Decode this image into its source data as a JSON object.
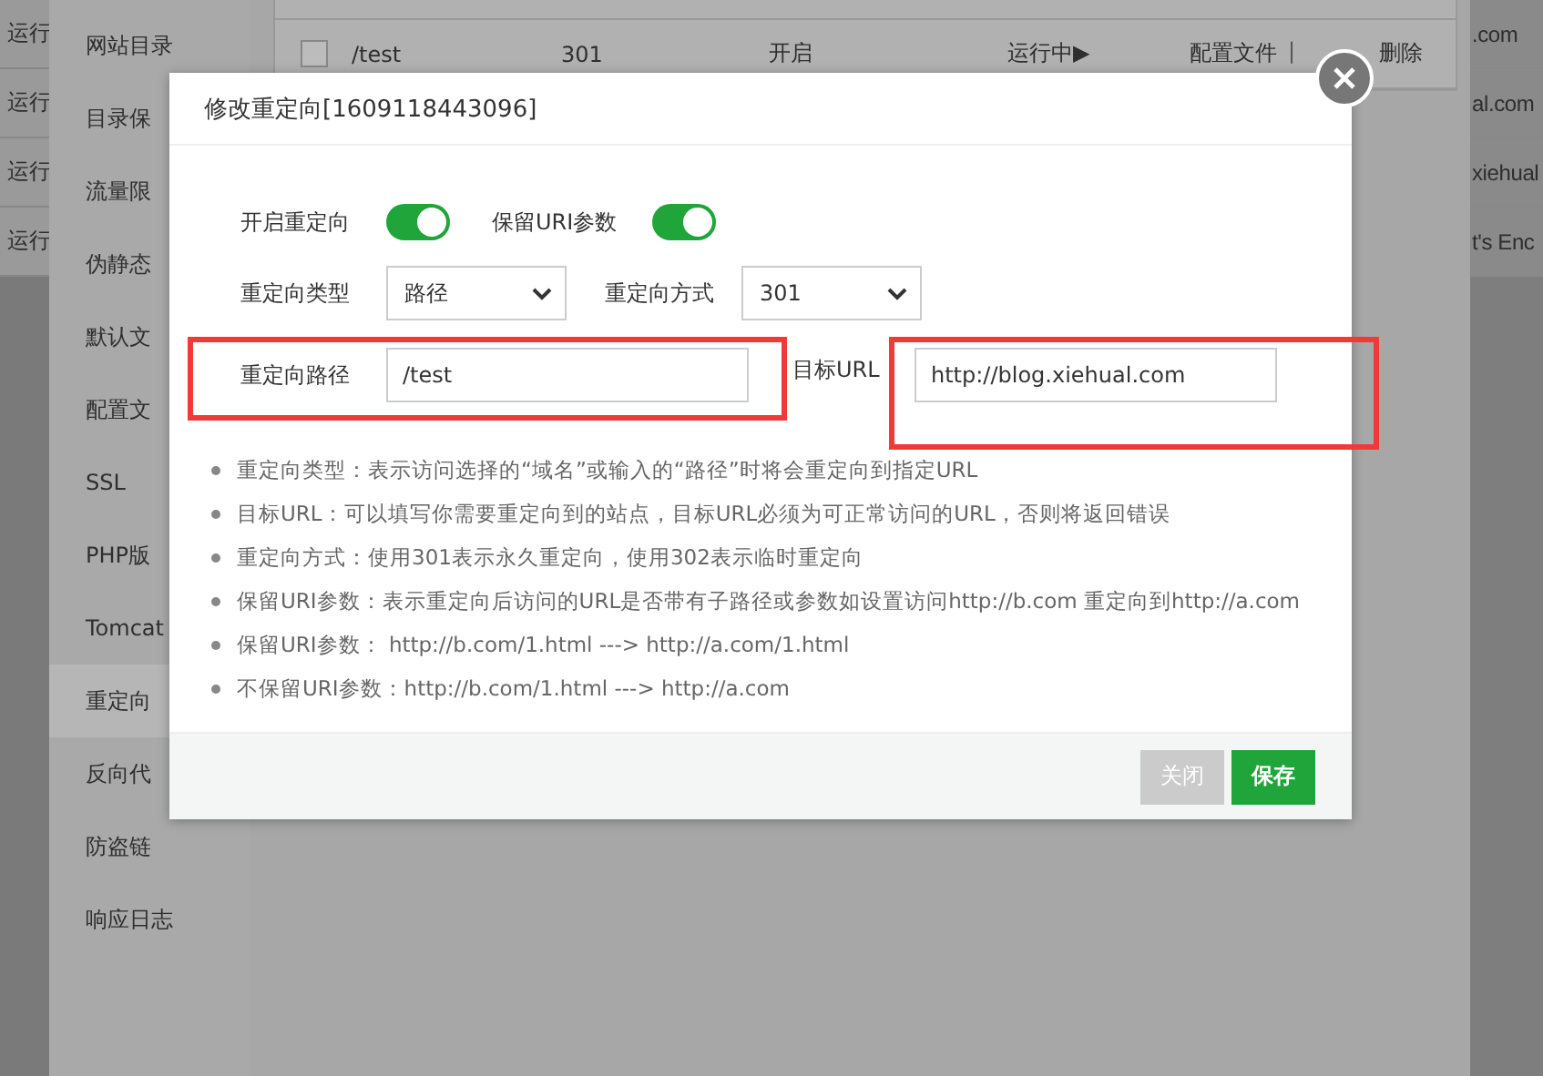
{
  "background_list": {
    "rows": [
      {
        "status": "运行",
        "site": ".com"
      },
      {
        "status": "运行",
        "site": "al.com"
      },
      {
        "status": "运行",
        "site": "xiehual"
      },
      {
        "status": "运行",
        "site": "t's Enc"
      }
    ]
  },
  "panel": {
    "sidebar": {
      "items": [
        {
          "label": "网站目录",
          "selected": false
        },
        {
          "label": "目录保",
          "selected": false
        },
        {
          "label": "流量限",
          "selected": false
        },
        {
          "label": "伪静态",
          "selected": false
        },
        {
          "label": "默认文",
          "selected": false
        },
        {
          "label": "配置文",
          "selected": false
        },
        {
          "label": "SSL",
          "selected": false
        },
        {
          "label": "PHP版",
          "selected": false
        },
        {
          "label": "Tomcat",
          "selected": false
        },
        {
          "label": "重定向",
          "selected": true
        },
        {
          "label": "反向代",
          "selected": false
        },
        {
          "label": "防盗链",
          "selected": false
        },
        {
          "label": "响应日志",
          "selected": false
        }
      ]
    },
    "table": {
      "rows": [
        {
          "checked": false,
          "path": "/test",
          "method": "301",
          "keep_params": "开启",
          "status": "运行中▶",
          "actions": [
            {
              "label": "配置文件",
              "kind": "link"
            },
            {
              "label": "|",
              "kind": "separator"
            },
            {
              "label": "删除",
              "kind": "link"
            }
          ]
        }
      ]
    }
  },
  "dialog": {
    "title": "修改重定向[1609118443096]",
    "switches": [
      {
        "label": "开启重定向",
        "on": true
      },
      {
        "label": "保留URI参数",
        "on": true
      }
    ],
    "selects": [
      {
        "label": "重定向类型",
        "value": "路径"
      },
      {
        "label": "重定向方式",
        "value": "301"
      }
    ],
    "fields": [
      {
        "label": "重定向路径",
        "value": "/test",
        "highlighted": true
      },
      {
        "label": "目标URL",
        "value": "http://blog.xiehual.com",
        "highlighted": true
      }
    ],
    "notes": [
      "重定向类型：表示访问选择的“域名”或输入的“路径”时将会重定向到指定URL",
      "目标URL：可以填写你需要重定向到的站点，目标URL必须为可正常访问的URL，否则将返回错误",
      "重定向方式：使用301表示永久重定向，使用302表示临时重定向",
      "保留URI参数：表示重定向后访问的URL是否带有子路径或参数如设置访问http://b.com 重定向到http://a.com",
      "保留URI参数： http://b.com/1.html ---> http://a.com/1.html",
      "不保留URI参数：http://b.com/1.html ---> http://a.com"
    ],
    "buttons": [
      {
        "label": "关闭",
        "kind": "secondary"
      },
      {
        "label": "保存",
        "kind": "primary"
      }
    ]
  }
}
